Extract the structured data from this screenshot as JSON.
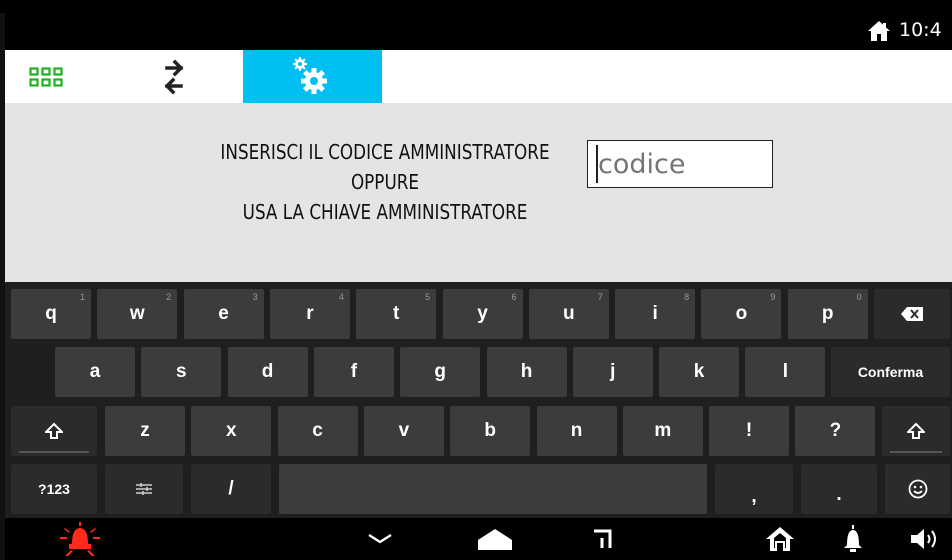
{
  "status_bar": {
    "time": "10:4",
    "home_icon": "home-icon"
  },
  "tabs": [
    {
      "name": "apps-tab",
      "icon": "grid-icon",
      "color": "#1db31d"
    },
    {
      "name": "transfer-tab",
      "icon": "swap-arrows-icon"
    },
    {
      "name": "settings-tab",
      "icon": "gears-icon",
      "active": true,
      "color": "#00bff2"
    }
  ],
  "content": {
    "prompt_line1": "INSERISCI IL CODICE AMMINISTRATORE",
    "prompt_line2": "OPPURE",
    "prompt_line3": "USA LA CHIAVE AMMINISTRATORE",
    "code_placeholder": "codice",
    "code_value": ""
  },
  "keyboard": {
    "row1": [
      {
        "label": "q",
        "hint": "1"
      },
      {
        "label": "w",
        "hint": "2"
      },
      {
        "label": "e",
        "hint": "3"
      },
      {
        "label": "r",
        "hint": "4"
      },
      {
        "label": "t",
        "hint": "5"
      },
      {
        "label": "y",
        "hint": "6"
      },
      {
        "label": "u",
        "hint": "7"
      },
      {
        "label": "i",
        "hint": "8"
      },
      {
        "label": "o",
        "hint": "9"
      },
      {
        "label": "p",
        "hint": "0"
      }
    ],
    "row2": [
      {
        "label": "a"
      },
      {
        "label": "s"
      },
      {
        "label": "d"
      },
      {
        "label": "f"
      },
      {
        "label": "g"
      },
      {
        "label": "h"
      },
      {
        "label": "j"
      },
      {
        "label": "k"
      },
      {
        "label": "l"
      }
    ],
    "confirm_label": "Conferma",
    "row3": [
      {
        "label": "z"
      },
      {
        "label": "x"
      },
      {
        "label": "c"
      },
      {
        "label": "v"
      },
      {
        "label": "b"
      },
      {
        "label": "n"
      },
      {
        "label": "m"
      },
      {
        "label": "!"
      },
      {
        "label": "?"
      }
    ],
    "symbols_label": "?123",
    "slash_label": "/",
    "comma_label": ",",
    "period_label": "."
  },
  "nav_bar": {
    "icons": [
      "alarm-icon",
      "back-chevron-icon",
      "home-nav-icon",
      "recents-icon",
      "home-icon",
      "bell-icon",
      "volume-icon"
    ],
    "alarm_color": "#ff2a1a"
  }
}
